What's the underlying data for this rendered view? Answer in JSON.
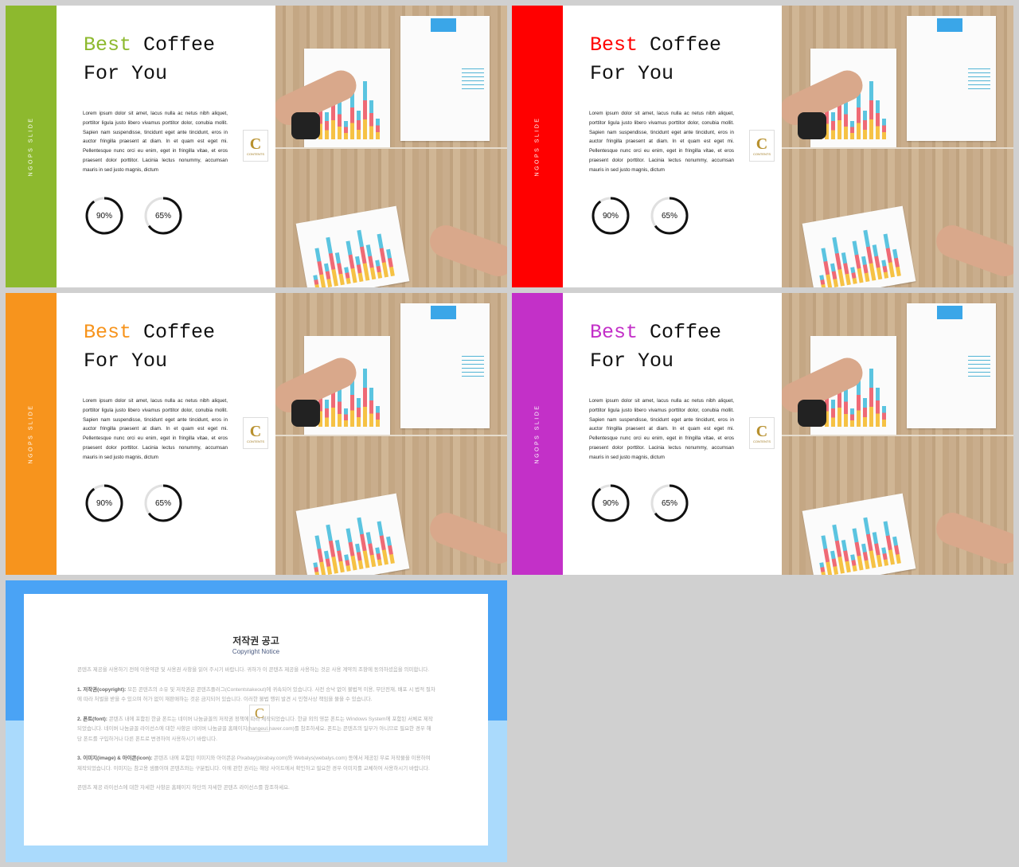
{
  "slides": [
    {
      "accent": "#8db92e",
      "side_label": "NGOPS SLIDE",
      "title_accent": "Best",
      "title_rest": " Coffee",
      "title_line2": "For You",
      "body": "Lorem ipsum dolor sit amet, lacus nulla ac netus nibh aliquet, porttitor ligula justo libero vivamus porttitor dolor, conubia mollit. Sapien nam suspendisse, tincidunt eget ante tincidunt, eros in auctor fringilla praesent at diam. In et quam est eget mi. Pellentesque nunc orci eu enim, eget in fringilla vitae, et eros praesent dolor porttitor. Lacinia lectus nonummy, accumsan mauris in sed justo magnis, dictum",
      "stat1": {
        "label": "90%",
        "value": 90
      },
      "stat2": {
        "label": "65%",
        "value": 65
      },
      "logo": "C",
      "logo_text": "CONTENTS"
    },
    {
      "accent": "#ff0000",
      "side_label": "NGOPS SLIDE",
      "title_accent": "Best",
      "title_rest": " Coffee",
      "title_line2": "For You",
      "body": "Lorem ipsum dolor sit amet, lacus nulla ac netus nibh aliquet, porttitor ligula justo libero vivamus porttitor dolor, conubia mollit. Sapien nam suspendisse, tincidunt eget ante tincidunt, eros in auctor fringilla praesent at diam. In et quam est eget mi. Pellentesque nunc orci eu enim, eget in fringilla vitae, et eros praesent dolor porttitor. Lacinia lectus nonummy, accumsan mauris in sed justo magnis, dictum",
      "stat1": {
        "label": "90%",
        "value": 90
      },
      "stat2": {
        "label": "65%",
        "value": 65
      },
      "logo": "C",
      "logo_text": "CONTENTS"
    },
    {
      "accent": "#f7941d",
      "side_label": "NGOPS SLIDE",
      "title_accent": "Best",
      "title_rest": " Coffee",
      "title_line2": "For You",
      "body": "Lorem ipsum dolor sit amet, lacus nulla ac netus nibh aliquet, porttitor ligula justo libero vivamus porttitor dolor, conubia mollit. Sapien nam suspendisse, tincidunt eget ante tincidunt, eros in auctor fringilla praesent at diam. In et quam est eget mi. Pellentesque nunc orci eu enim, eget in fringilla vitae, et eros praesent dolor porttitor. Lacinia lectus nonummy, accumsan mauris in sed justo magnis, dictum",
      "stat1": {
        "label": "90%",
        "value": 90
      },
      "stat2": {
        "label": "65%",
        "value": 65
      },
      "logo": "C",
      "logo_text": "CONTENTS"
    },
    {
      "accent": "#c330c8",
      "side_label": "NGOPS SLIDE",
      "title_accent": "Best",
      "title_rest": " Coffee",
      "title_line2": "For You",
      "body": "Lorem ipsum dolor sit amet, lacus nulla ac netus nibh aliquet, porttitor ligula justo libero vivamus porttitor dolor, conubia mollit. Sapien nam suspendisse, tincidunt eget ante tincidunt, eros in auctor fringilla praesent at diam. In et quam est eget mi. Pellentesque nunc orci eu enim, eget in fringilla vitae, et eros praesent dolor porttitor. Lacinia lectus nonummy, accumsan mauris in sed justo magnis, dictum",
      "stat1": {
        "label": "90%",
        "value": 90
      },
      "stat2": {
        "label": "65%",
        "value": 65
      },
      "logo": "C",
      "logo_text": "CONTENTS"
    }
  ],
  "copyright": {
    "title": "저작권 공고",
    "subtitle": "Copyright Notice",
    "intro": "콘텐츠 제공을 사용하기 전에 이용약관 및 사용권 사항을 읽어 주시기 바랍니다. 귀하가 이 콘텐츠 제공을 사용하는 것은 사용 계약의 조항에 동의하셨음을 의미합니다.",
    "s1_head": "1. 저작권(copyright):",
    "s1_body": " 모든 콘텐츠의 소유 및 저작권은 콘텐츠플러그(Contentstakeout)에 귀속되어 있습니다. 사전 승낙 없이 불법적 이용, 무단전재, 배포 시 법적 절차에 따라 처벌을 받을 수 있으며 허가 없이 재판매하는 것은 금지되어 있습니다. 이러한 불법 행위 발견 시 민형사상 책임을 물을 수 있습니다.",
    "s2_head": "2. 폰트(font):",
    "s2_body": " 콘텐츠 내에 포함된 한글 폰트는 네이버 나눔글꼴의 저작권 정책에 따라 제작되었습니다. 한글 외의 영문 폰트는 Windows System에 포함된 서체로 제작되었습니다. 네이버 나눔글꼴 라이선스에 대한 사항은 네이버 나눔글꼴 홈페이지(hangeul.naver.com)를 참조하세요. 폰트는 콘텐츠의 일부가 아니므로 필요한 경우 해당 폰트를 구입하거나 다른 폰트로 변경하여 사용하시기 바랍니다.",
    "s3_head": "3. 이미지(image) & 아이콘(icon):",
    "s3_body": " 콘텐츠 내에 포함된 이미지와 아이콘은 Pixabay(pixabay.com)와 Webalys(webalys.com) 등에서 제공된 무료 저작물을 이용하여 제작되었습니다. 이미지는 참고용 샘플이며 콘텐츠와는 구분됩니다. 이에 관한 권리는 해당 사이트에서 확인하고 필요한 경우 이미지를 교체하여 사용하시기 바랍니다.",
    "outro": "콘텐츠 제공 라이선스에 대한 자세한 사항은 홈페이지 하단의 자세한 콘텐츠 라이선스를 참조하세요.",
    "logo": "C",
    "top_color": "#4aa3f5",
    "bottom_color": "#aadafc"
  }
}
